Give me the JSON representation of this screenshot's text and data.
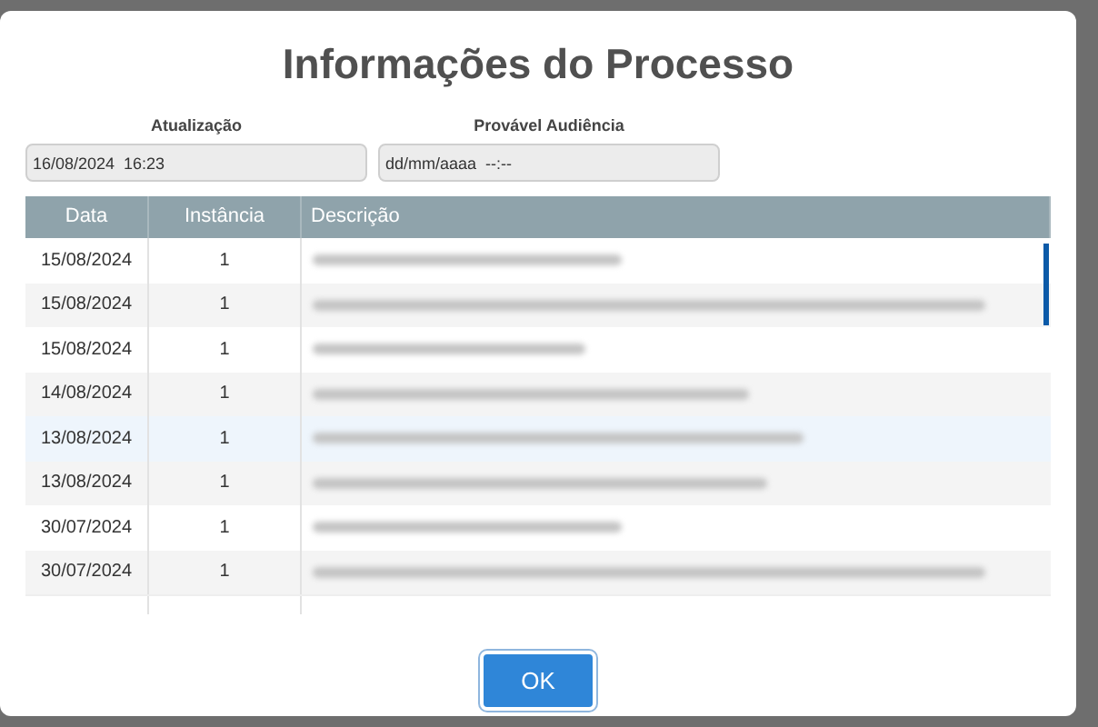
{
  "dialog": {
    "title": "Informações do Processo"
  },
  "fields": [
    {
      "label": "Atualização",
      "value": "16/08/2024  16:23"
    },
    {
      "label": "Provável Audiência",
      "placeholder": "dd/mm/aaaa  --:--"
    }
  ],
  "table": {
    "columns": [
      "Data",
      "Instância",
      "Descrição"
    ],
    "rows": [
      {
        "date": "15/08/2024",
        "instance": "1",
        "redacted": true,
        "selected": false
      },
      {
        "date": "15/08/2024",
        "instance": "1",
        "redacted": true,
        "selected": false
      },
      {
        "date": "15/08/2024",
        "instance": "1",
        "redacted": true,
        "selected": false
      },
      {
        "date": "14/08/2024",
        "instance": "1",
        "redacted": true,
        "selected": false
      },
      {
        "date": "13/08/2024",
        "instance": "1",
        "redacted": true,
        "selected": true
      },
      {
        "date": "13/08/2024",
        "instance": "1",
        "redacted": true,
        "selected": false
      },
      {
        "date": "30/07/2024",
        "instance": "1",
        "redacted": true,
        "selected": false
      },
      {
        "date": "30/07/2024",
        "instance": "1",
        "redacted": true,
        "selected": false
      }
    ]
  },
  "buttons": [
    "OK"
  ]
}
